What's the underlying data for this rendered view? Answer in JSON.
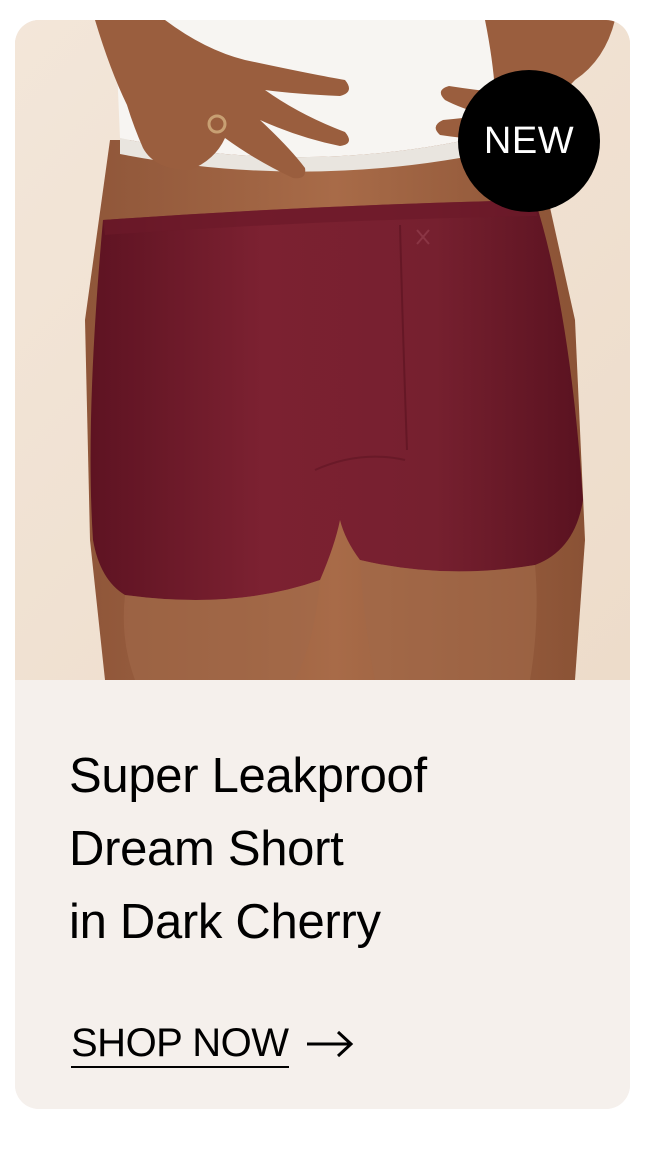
{
  "product_card": {
    "badge": "NEW",
    "title_lines": [
      "Super Leakproof",
      "Dream Short",
      "in Dark Cherry"
    ],
    "cta_label": "SHOP NOW",
    "cta_icon": "arrow-right-icon",
    "colors": {
      "product": "#7a1f2f",
      "badge_bg": "#000000",
      "card_bg": "#f5f0ec",
      "photo_bg": "#efe2d5"
    }
  }
}
